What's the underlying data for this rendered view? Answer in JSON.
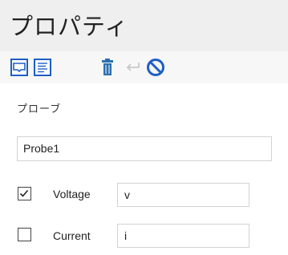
{
  "panel": {
    "title": "プロパティ"
  },
  "toolbar": {
    "buttons": [
      {
        "icon": "panel-view-icon",
        "active": true
      },
      {
        "icon": "list-view-icon",
        "active": false
      },
      {
        "icon": "trash-icon"
      },
      {
        "icon": "return-arrow-icon"
      },
      {
        "icon": "no-symbol-icon"
      }
    ]
  },
  "probe": {
    "section_label": "プローブ",
    "name_value": "Probe1"
  },
  "rows": [
    {
      "label": "Voltage",
      "checked": true,
      "value": "v"
    },
    {
      "label": "Current",
      "checked": false,
      "value": "i"
    }
  ],
  "colors": {
    "accent": "#1e5fc4",
    "title_bg": "#efefef",
    "border": "#d2d2d2"
  }
}
